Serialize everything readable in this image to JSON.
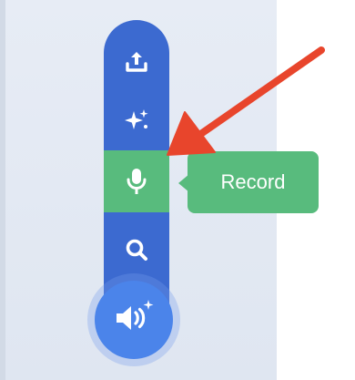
{
  "tooltip": {
    "label": "Record"
  },
  "menu": {
    "items": [
      {
        "icon": "upload-icon"
      },
      {
        "icon": "sparkles-icon"
      },
      {
        "icon": "microphone-icon",
        "active": true
      },
      {
        "icon": "search-icon"
      }
    ],
    "main_button_icon": "speaker-sparkle-icon"
  },
  "colors": {
    "menu_blue": "#3c6ad0",
    "active_green": "#58bb7d",
    "main_button_blue": "#4b84ea",
    "annotation_arrow": "#e8452c",
    "panel_background": "#e5ebf4"
  }
}
